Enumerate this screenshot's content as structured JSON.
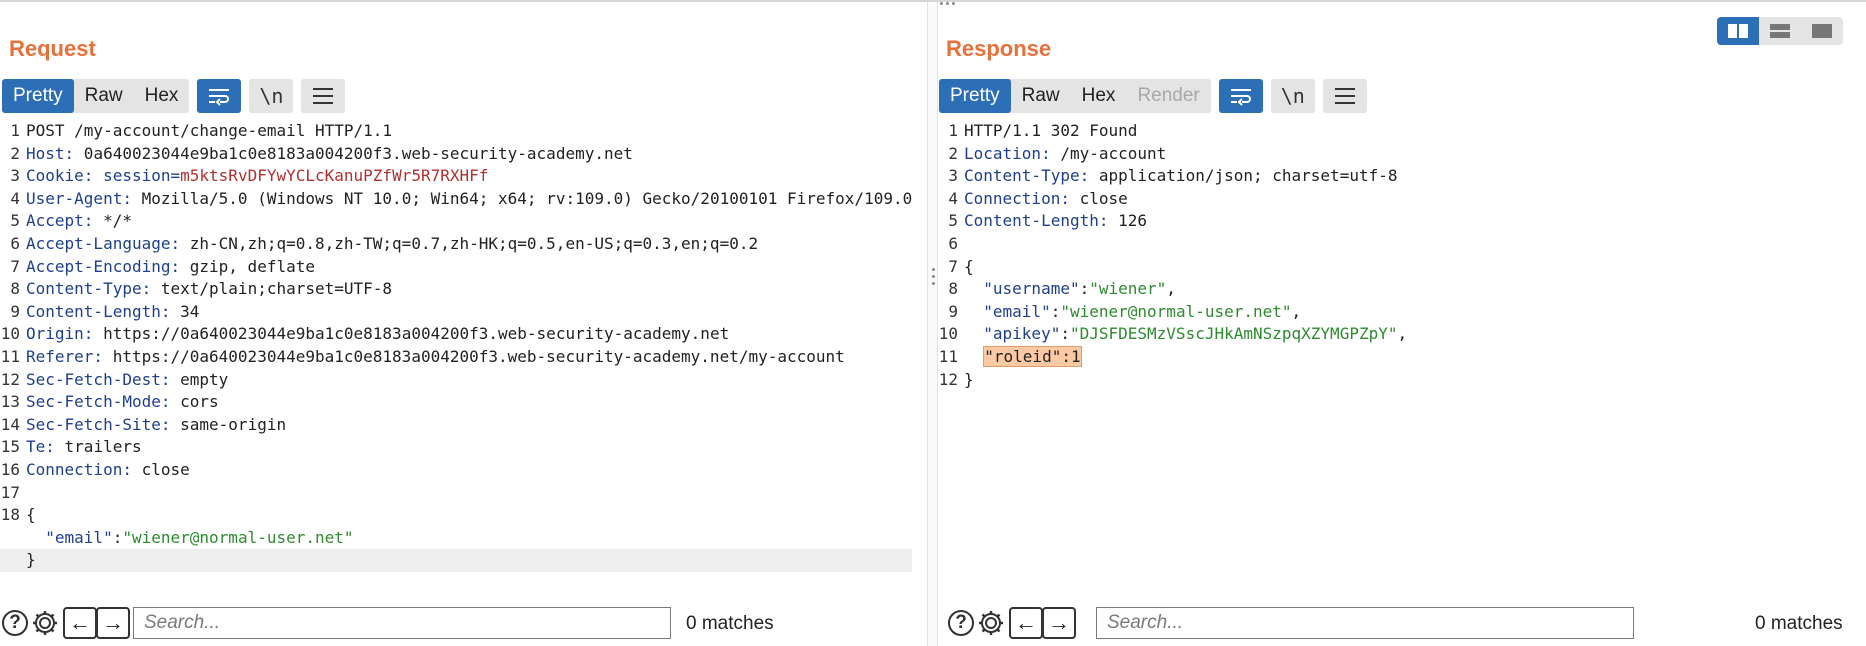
{
  "request": {
    "title": "Request",
    "tabs": [
      {
        "label": "Pretty",
        "active": true
      },
      {
        "label": "Raw"
      },
      {
        "label": "Hex"
      }
    ],
    "newline_label": "\\n",
    "lines": [
      {
        "n": "1",
        "parts": [
          {
            "t": "POST /my-account/change-email HTTP/1.1"
          }
        ]
      },
      {
        "n": "2",
        "parts": [
          {
            "t": "Host:",
            "c": "hk"
          },
          {
            "t": " 0a640023044e9ba1c0e8183a004200f3.web-security-academy.net"
          }
        ]
      },
      {
        "n": "3",
        "parts": [
          {
            "t": "Cookie:",
            "c": "hk"
          },
          {
            "t": " "
          },
          {
            "t": "session=",
            "c": "hk"
          },
          {
            "t": "m5ktsRvDFYwYCLcKanuPZfWr5R7RXHFf",
            "c": "cookie"
          }
        ]
      },
      {
        "n": "4",
        "parts": [
          {
            "t": "User-Agent:",
            "c": "hk"
          },
          {
            "t": " Mozilla/5.0 (Windows NT 10.0; Win64; x64; rv:109.0) Gecko/20100101 Firefox/109.0"
          }
        ]
      },
      {
        "n": "5",
        "parts": [
          {
            "t": "Accept:",
            "c": "hk"
          },
          {
            "t": " */*"
          }
        ]
      },
      {
        "n": "6",
        "parts": [
          {
            "t": "Accept-Language:",
            "c": "hk"
          },
          {
            "t": " zh-CN,zh;q=0.8,zh-TW;q=0.7,zh-HK;q=0.5,en-US;q=0.3,en;q=0.2"
          }
        ]
      },
      {
        "n": "7",
        "parts": [
          {
            "t": "Accept-Encoding:",
            "c": "hk"
          },
          {
            "t": " gzip, deflate"
          }
        ]
      },
      {
        "n": "8",
        "parts": [
          {
            "t": "Content-Type:",
            "c": "hk"
          },
          {
            "t": " text/plain;charset=UTF-8"
          }
        ]
      },
      {
        "n": "9",
        "parts": [
          {
            "t": "Content-Length:",
            "c": "hk"
          },
          {
            "t": " 34"
          }
        ]
      },
      {
        "n": "10",
        "parts": [
          {
            "t": "Origin:",
            "c": "hk"
          },
          {
            "t": " https://0a640023044e9ba1c0e8183a004200f3.web-security-academy.net"
          }
        ]
      },
      {
        "n": "11",
        "parts": [
          {
            "t": "Referer:",
            "c": "hk"
          },
          {
            "t": " https://0a640023044e9ba1c0e8183a004200f3.web-security-academy.net/my-account"
          }
        ]
      },
      {
        "n": "12",
        "parts": [
          {
            "t": "Sec-Fetch-Dest:",
            "c": "hk"
          },
          {
            "t": " empty"
          }
        ]
      },
      {
        "n": "13",
        "parts": [
          {
            "t": "Sec-Fetch-Mode:",
            "c": "hk"
          },
          {
            "t": " cors"
          }
        ]
      },
      {
        "n": "14",
        "parts": [
          {
            "t": "Sec-Fetch-Site:",
            "c": "hk"
          },
          {
            "t": " same-origin"
          }
        ]
      },
      {
        "n": "15",
        "parts": [
          {
            "t": "Te:",
            "c": "hk"
          },
          {
            "t": " trailers"
          }
        ]
      },
      {
        "n": "16",
        "parts": [
          {
            "t": "Connection:",
            "c": "hk"
          },
          {
            "t": " close"
          }
        ]
      },
      {
        "n": "17",
        "parts": [
          {
            "t": ""
          }
        ]
      },
      {
        "n": "18",
        "parts": [
          {
            "t": "{"
          }
        ]
      },
      {
        "n": "",
        "parts": [
          {
            "t": "  "
          },
          {
            "t": "\"email\"",
            "c": "hk"
          },
          {
            "t": ":"
          },
          {
            "t": "\"wiener@normal-user.net\"",
            "c": "str"
          }
        ]
      },
      {
        "n": "",
        "parts": [
          {
            "t": "}"
          }
        ],
        "highlight": true
      }
    ],
    "search": {
      "placeholder": "Search...",
      "matches": "0 matches"
    }
  },
  "response": {
    "title": "Response",
    "tabs": [
      {
        "label": "Pretty",
        "active": true
      },
      {
        "label": "Raw"
      },
      {
        "label": "Hex"
      },
      {
        "label": "Render",
        "disabled": true
      }
    ],
    "newline_label": "\\n",
    "lines": [
      {
        "n": "1",
        "parts": [
          {
            "t": "HTTP/1.1 302 Found"
          }
        ]
      },
      {
        "n": "2",
        "parts": [
          {
            "t": "Location:",
            "c": "hk"
          },
          {
            "t": " /my-account"
          }
        ]
      },
      {
        "n": "3",
        "parts": [
          {
            "t": "Content-Type:",
            "c": "hk"
          },
          {
            "t": " application/json; charset=utf-8"
          }
        ]
      },
      {
        "n": "4",
        "parts": [
          {
            "t": "Connection:",
            "c": "hk"
          },
          {
            "t": " close"
          }
        ]
      },
      {
        "n": "5",
        "parts": [
          {
            "t": "Content-Length:",
            "c": "hk"
          },
          {
            "t": " 126"
          }
        ]
      },
      {
        "n": "6",
        "parts": [
          {
            "t": ""
          }
        ]
      },
      {
        "n": "7",
        "parts": [
          {
            "t": "{"
          }
        ]
      },
      {
        "n": "8",
        "parts": [
          {
            "t": "  "
          },
          {
            "t": "\"username\"",
            "c": "hk"
          },
          {
            "t": ":"
          },
          {
            "t": "\"wiener\"",
            "c": "str"
          },
          {
            "t": ","
          }
        ]
      },
      {
        "n": "9",
        "parts": [
          {
            "t": "  "
          },
          {
            "t": "\"email\"",
            "c": "hk"
          },
          {
            "t": ":"
          },
          {
            "t": "\"wiener@normal-user.net\"",
            "c": "str"
          },
          {
            "t": ","
          }
        ]
      },
      {
        "n": "10",
        "parts": [
          {
            "t": "  "
          },
          {
            "t": "\"apikey\"",
            "c": "hk"
          },
          {
            "t": ":"
          },
          {
            "t": "\"DJSFDESMzVSscJHkAmNSzpqXZYMGPZpY\"",
            "c": "str"
          },
          {
            "t": ","
          }
        ]
      },
      {
        "n": "11",
        "parts": [
          {
            "t": "  "
          },
          {
            "t": "\"roleid\":1",
            "c": "token"
          }
        ]
      },
      {
        "n": "12",
        "parts": [
          {
            "t": "}"
          }
        ]
      }
    ],
    "search": {
      "placeholder": "Search...",
      "matches": "0 matches"
    }
  },
  "colors": {
    "title_orange": "#e8703a",
    "accent_blue": "#2d6fb6",
    "header_key_blue": "#1e3f8f",
    "string_green": "#2e8b2e",
    "cookie_red": "#b33030",
    "token_highlight": "#fbc9a4"
  },
  "icons": {
    "wrap": "wrap-lines-icon",
    "newline": "show-newlines-icon",
    "menu": "hamburger-menu-icon",
    "help": "help-icon",
    "settings": "gear-icon",
    "prev": "arrow-left-icon",
    "next": "arrow-right-icon",
    "layout": [
      "side-by-side-layout-icon",
      "stacked-layout-icon",
      "single-pane-layout-icon"
    ]
  }
}
